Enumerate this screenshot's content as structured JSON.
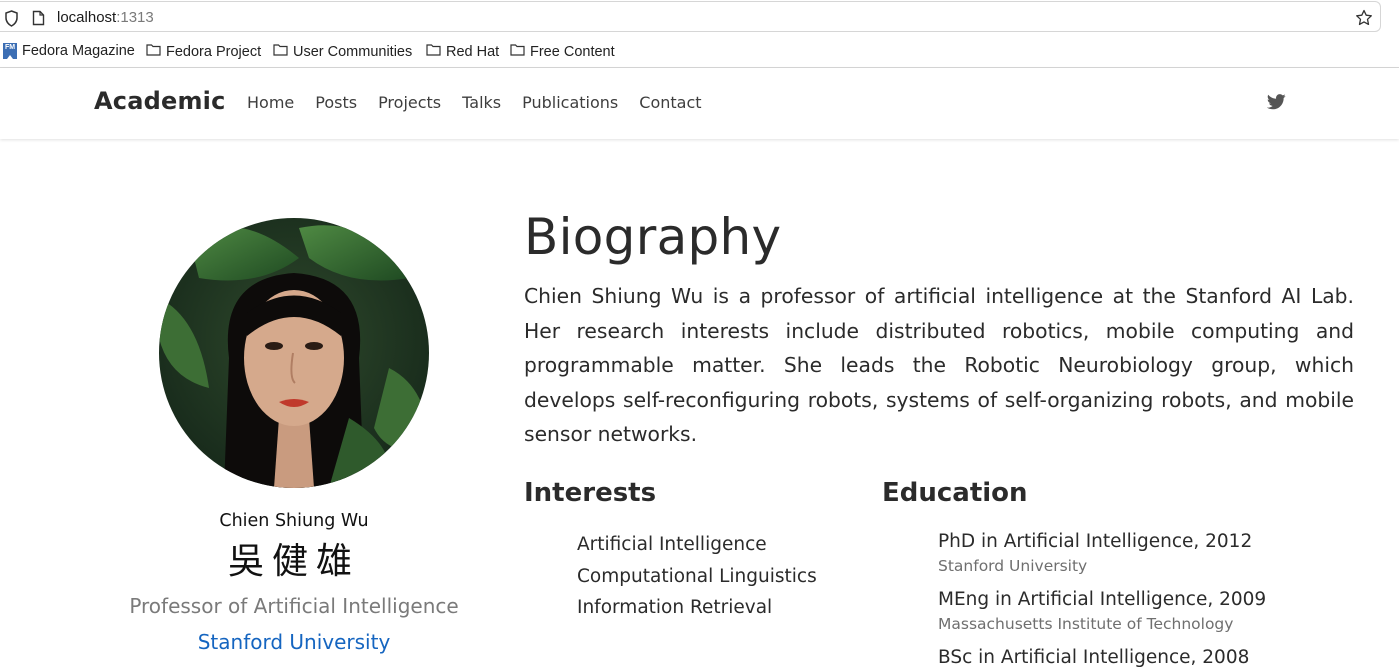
{
  "browser": {
    "url_host": "localhost",
    "url_port": ":1313",
    "bookmarks": [
      "Fedora Magazine",
      "Fedora Project",
      "User Communities",
      "Red Hat",
      "Free Content"
    ],
    "fedora_badge": "FM"
  },
  "nav": {
    "brand": "Academic",
    "links": [
      "Home",
      "Posts",
      "Projects",
      "Talks",
      "Publications",
      "Contact"
    ]
  },
  "profile": {
    "name": "Chien Shiung Wu",
    "name_cjk": "吳健雄",
    "role": "Professor of Artificial Intelligence",
    "organization": "Stanford University"
  },
  "biography": {
    "heading": "Biography",
    "text": "Chien Shiung Wu is a professor of artificial intelligence at the Stanford AI Lab. Her research interests include distributed robotics, mobile computing and programmable matter. She leads the Robotic Neurobiology group, which develops self-reconfiguring robots, systems of self-organizing robots, and mobile sensor networks."
  },
  "interests": {
    "heading": "Interests",
    "items": [
      "Artificial Intelligence",
      "Computational Linguistics",
      "Information Retrieval"
    ]
  },
  "education": {
    "heading": "Education",
    "items": [
      {
        "degree": "PhD in Artificial Intelligence, 2012",
        "institution": "Stanford University"
      },
      {
        "degree": "MEng in Artificial Intelligence, 2009",
        "institution": "Massachusetts Institute of Technology"
      },
      {
        "degree": "BSc in Artificial Intelligence, 2008",
        "institution": ""
      }
    ]
  },
  "colors": {
    "link_blue": "#1565c0",
    "muted_text": "#7a7a7a",
    "twitter_icon": "#555555"
  },
  "icons": [
    "shield-icon",
    "page-icon",
    "bookmark-star-icon",
    "folder-icon",
    "twitter-icon"
  ]
}
